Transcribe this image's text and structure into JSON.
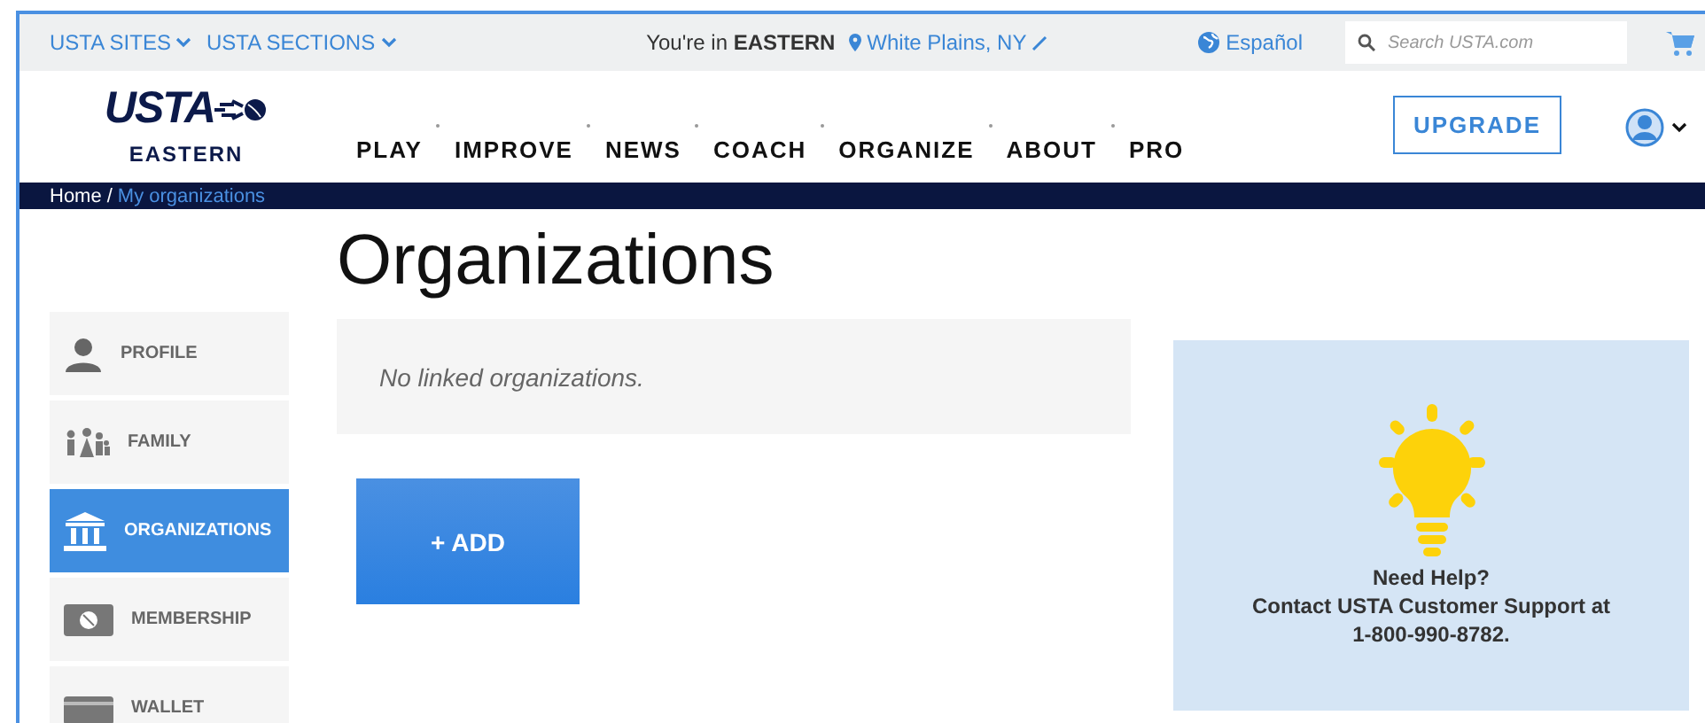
{
  "top_bar": {
    "site_links": [
      {
        "label": "USTA SITES"
      },
      {
        "label": "USTA SECTIONS"
      }
    ],
    "location_text": "You're in **EASTERN**",
    "location_link": "White Plains, NY",
    "language_link": "Español",
    "search": {
      "placeholder": "Search USTA.com"
    }
  },
  "header": {
    "logo": {
      "wordmark": "USTA",
      "section": "EASTERN"
    },
    "nav": [
      "PLAY",
      "IMPROVE",
      "NEWS",
      "COACH",
      "ORGANIZE",
      "ABOUT",
      "PRO"
    ],
    "upgrade_button": "UPGRADE"
  },
  "breadcrumb": {
    "home": "Home",
    "separator": "/",
    "current": "My organizations"
  },
  "page_title": "Organizations",
  "sidebar": {
    "items": [
      {
        "label": "PROFILE",
        "selected": false
      },
      {
        "label": "FAMILY",
        "selected": false
      },
      {
        "label": "ORGANIZATIONS",
        "selected": true
      },
      {
        "label": "MEMBERSHIP",
        "selected": false
      },
      {
        "label": "WALLET",
        "selected": false
      }
    ]
  },
  "organizations": {
    "empty_message": "No linked organizations.",
    "add_button": "+ ADD"
  },
  "help": {
    "title": "Need Help?",
    "lines": [
      "Contact USTA Customer Support at",
      "1-800-990-8782."
    ]
  }
}
